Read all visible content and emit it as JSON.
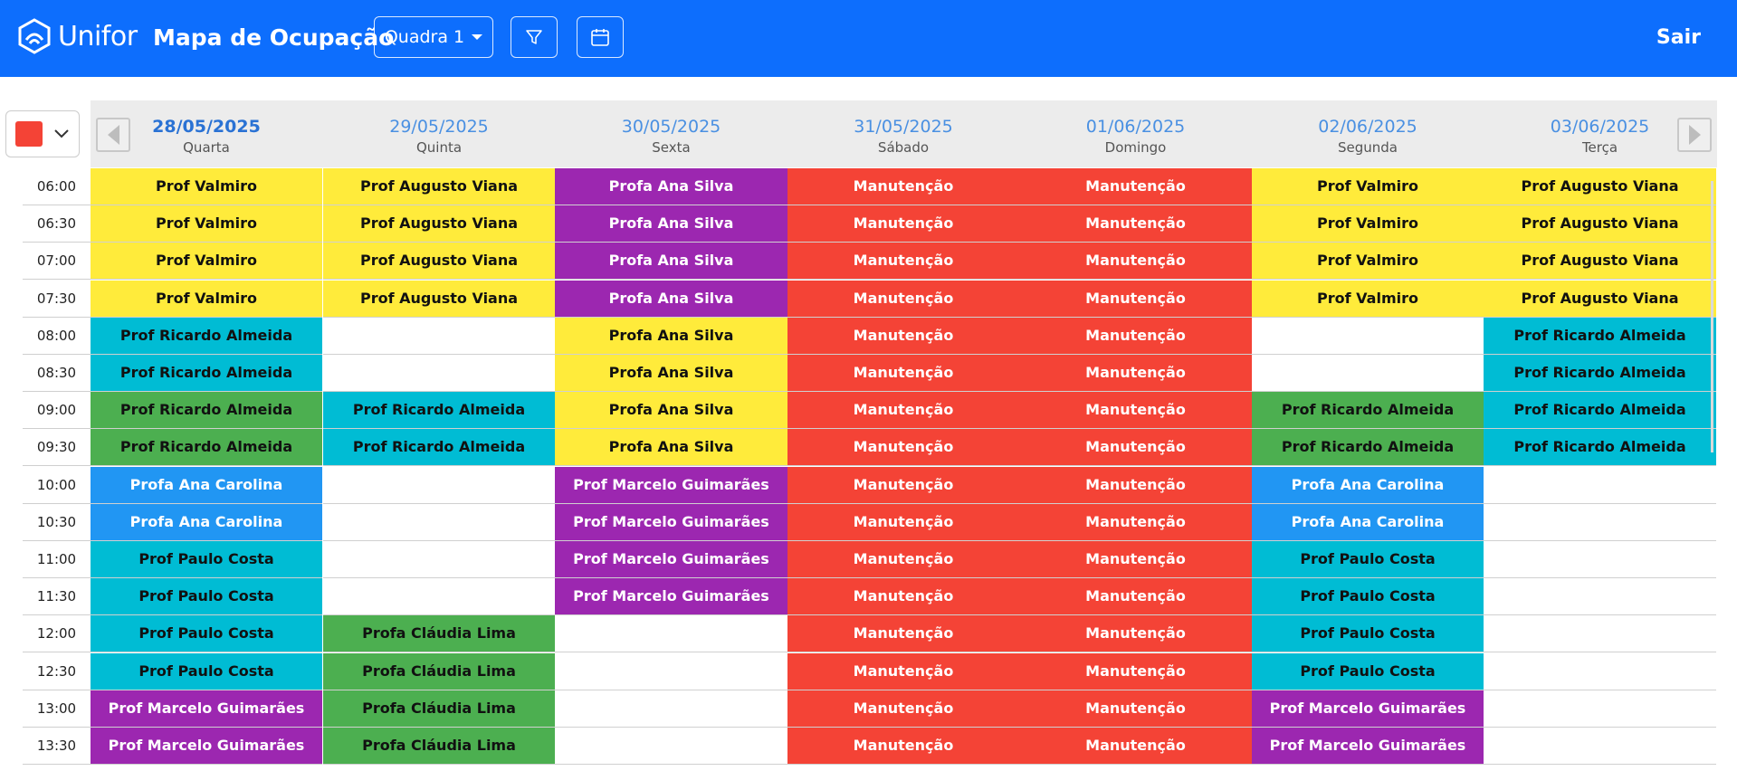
{
  "header": {
    "logo_text": "Unifor",
    "title": "Mapa de Ocupação",
    "quadra_label": "Quadra 1",
    "logout_label": "Sair",
    "background_color": "#0d6efd",
    "filter_icon": "filter-icon",
    "calendar_icon": "calendar-icon"
  },
  "color_picker": {
    "selected_color": "#f44336"
  },
  "days": [
    {
      "date": "28/05/2025",
      "weekday": "Quarta",
      "current": true
    },
    {
      "date": "29/05/2025",
      "weekday": "Quinta"
    },
    {
      "date": "30/05/2025",
      "weekday": "Sexta"
    },
    {
      "date": "31/05/2025",
      "weekday": "Sábado"
    },
    {
      "date": "01/06/2025",
      "weekday": "Domingo"
    },
    {
      "date": "02/06/2025",
      "weekday": "Segunda"
    },
    {
      "date": "03/06/2025",
      "weekday": "Terça"
    }
  ],
  "colors": {
    "yellow": "#ffeb3b",
    "purple": "#9c27b0",
    "red": "#f44336",
    "cyan": "#00bcd4",
    "green": "#4caf50",
    "blue": "#2196f3",
    "empty": "#ffffff"
  },
  "schedule": [
    {
      "time": "06:00",
      "cells": [
        [
          "Prof Valmiro",
          "yellow"
        ],
        [
          "Prof Augusto Viana",
          "yellow"
        ],
        [
          "Profa Ana Silva",
          "purple"
        ],
        [
          "Manutenção",
          "red"
        ],
        [
          "Manutenção",
          "red"
        ],
        [
          "Prof Valmiro",
          "yellow"
        ],
        [
          "Prof Augusto Viana",
          "yellow"
        ]
      ]
    },
    {
      "time": "06:30",
      "cells": [
        [
          "Prof Valmiro",
          "yellow"
        ],
        [
          "Prof Augusto Viana",
          "yellow"
        ],
        [
          "Profa Ana Silva",
          "purple"
        ],
        [
          "Manutenção",
          "red"
        ],
        [
          "Manutenção",
          "red"
        ],
        [
          "Prof Valmiro",
          "yellow"
        ],
        [
          "Prof Augusto Viana",
          "yellow"
        ]
      ]
    },
    {
      "time": "07:00",
      "cells": [
        [
          "Prof Valmiro",
          "yellow"
        ],
        [
          "Prof Augusto Viana",
          "yellow"
        ],
        [
          "Profa Ana Silva",
          "purple"
        ],
        [
          "Manutenção",
          "red"
        ],
        [
          "Manutenção",
          "red"
        ],
        [
          "Prof Valmiro",
          "yellow"
        ],
        [
          "Prof Augusto Viana",
          "yellow"
        ]
      ]
    },
    {
      "time": "07:30",
      "cells": [
        [
          "Prof Valmiro",
          "yellow"
        ],
        [
          "Prof Augusto Viana",
          "yellow"
        ],
        [
          "Profa Ana Silva",
          "purple"
        ],
        [
          "Manutenção",
          "red"
        ],
        [
          "Manutenção",
          "red"
        ],
        [
          "Prof Valmiro",
          "yellow"
        ],
        [
          "Prof Augusto Viana",
          "yellow"
        ]
      ]
    },
    {
      "time": "08:00",
      "cells": [
        [
          "Prof Ricardo Almeida",
          "cyan"
        ],
        [
          "",
          "empty"
        ],
        [
          "Profa Ana Silva",
          "yellow"
        ],
        [
          "Manutenção",
          "red"
        ],
        [
          "Manutenção",
          "red"
        ],
        [
          "",
          "empty"
        ],
        [
          "Prof Ricardo Almeida",
          "cyan"
        ]
      ]
    },
    {
      "time": "08:30",
      "cells": [
        [
          "Prof Ricardo Almeida",
          "cyan"
        ],
        [
          "",
          "empty"
        ],
        [
          "Profa Ana Silva",
          "yellow"
        ],
        [
          "Manutenção",
          "red"
        ],
        [
          "Manutenção",
          "red"
        ],
        [
          "",
          "empty"
        ],
        [
          "Prof Ricardo Almeida",
          "cyan"
        ]
      ]
    },
    {
      "time": "09:00",
      "cells": [
        [
          "Prof Ricardo Almeida",
          "green"
        ],
        [
          "Prof Ricardo Almeida",
          "cyan"
        ],
        [
          "Profa Ana Silva",
          "yellow"
        ],
        [
          "Manutenção",
          "red"
        ],
        [
          "Manutenção",
          "red"
        ],
        [
          "Prof Ricardo Almeida",
          "green"
        ],
        [
          "Prof Ricardo Almeida",
          "cyan"
        ]
      ]
    },
    {
      "time": "09:30",
      "cells": [
        [
          "Prof Ricardo Almeida",
          "green"
        ],
        [
          "Prof Ricardo Almeida",
          "cyan"
        ],
        [
          "Profa Ana Silva",
          "yellow"
        ],
        [
          "Manutenção",
          "red"
        ],
        [
          "Manutenção",
          "red"
        ],
        [
          "Prof Ricardo Almeida",
          "green"
        ],
        [
          "Prof Ricardo Almeida",
          "cyan"
        ]
      ]
    },
    {
      "time": "10:00",
      "cells": [
        [
          "Profa Ana Carolina",
          "blue"
        ],
        [
          "",
          "empty"
        ],
        [
          "Prof Marcelo Guimarães",
          "purple"
        ],
        [
          "Manutenção",
          "red"
        ],
        [
          "Manutenção",
          "red"
        ],
        [
          "Profa Ana Carolina",
          "blue"
        ],
        [
          "",
          "empty"
        ]
      ]
    },
    {
      "time": "10:30",
      "cells": [
        [
          "Profa Ana Carolina",
          "blue"
        ],
        [
          "",
          "empty"
        ],
        [
          "Prof Marcelo Guimarães",
          "purple"
        ],
        [
          "Manutenção",
          "red"
        ],
        [
          "Manutenção",
          "red"
        ],
        [
          "Profa Ana Carolina",
          "blue"
        ],
        [
          "",
          "empty"
        ]
      ]
    },
    {
      "time": "11:00",
      "cells": [
        [
          "Prof Paulo Costa",
          "cyan"
        ],
        [
          "",
          "empty"
        ],
        [
          "Prof Marcelo Guimarães",
          "purple"
        ],
        [
          "Manutenção",
          "red"
        ],
        [
          "Manutenção",
          "red"
        ],
        [
          "Prof Paulo Costa",
          "cyan"
        ],
        [
          "",
          "empty"
        ]
      ]
    },
    {
      "time": "11:30",
      "cells": [
        [
          "Prof Paulo Costa",
          "cyan"
        ],
        [
          "",
          "empty"
        ],
        [
          "Prof Marcelo Guimarães",
          "purple"
        ],
        [
          "Manutenção",
          "red"
        ],
        [
          "Manutenção",
          "red"
        ],
        [
          "Prof Paulo Costa",
          "cyan"
        ],
        [
          "",
          "empty"
        ]
      ]
    },
    {
      "time": "12:00",
      "cells": [
        [
          "Prof Paulo Costa",
          "cyan"
        ],
        [
          "Profa Cláudia Lima",
          "green"
        ],
        [
          "",
          "empty"
        ],
        [
          "Manutenção",
          "red"
        ],
        [
          "Manutenção",
          "red"
        ],
        [
          "Prof Paulo Costa",
          "cyan"
        ],
        [
          "",
          "empty"
        ]
      ]
    },
    {
      "time": "12:30",
      "cells": [
        [
          "Prof Paulo Costa",
          "cyan"
        ],
        [
          "Profa Cláudia Lima",
          "green"
        ],
        [
          "",
          "empty"
        ],
        [
          "Manutenção",
          "red"
        ],
        [
          "Manutenção",
          "red"
        ],
        [
          "Prof Paulo Costa",
          "cyan"
        ],
        [
          "",
          "empty"
        ]
      ]
    },
    {
      "time": "13:00",
      "cells": [
        [
          "Prof Marcelo Guimarães",
          "purple"
        ],
        [
          "Profa Cláudia Lima",
          "green"
        ],
        [
          "",
          "empty"
        ],
        [
          "Manutenção",
          "red"
        ],
        [
          "Manutenção",
          "red"
        ],
        [
          "Prof Marcelo Guimarães",
          "purple"
        ],
        [
          "",
          "empty"
        ]
      ]
    },
    {
      "time": "13:30",
      "cells": [
        [
          "Prof Marcelo Guimarães",
          "purple"
        ],
        [
          "Profa Cláudia Lima",
          "green"
        ],
        [
          "",
          "empty"
        ],
        [
          "Manutenção",
          "red"
        ],
        [
          "Manutenção",
          "red"
        ],
        [
          "Prof Marcelo Guimarães",
          "purple"
        ],
        [
          "",
          "empty"
        ]
      ]
    }
  ]
}
